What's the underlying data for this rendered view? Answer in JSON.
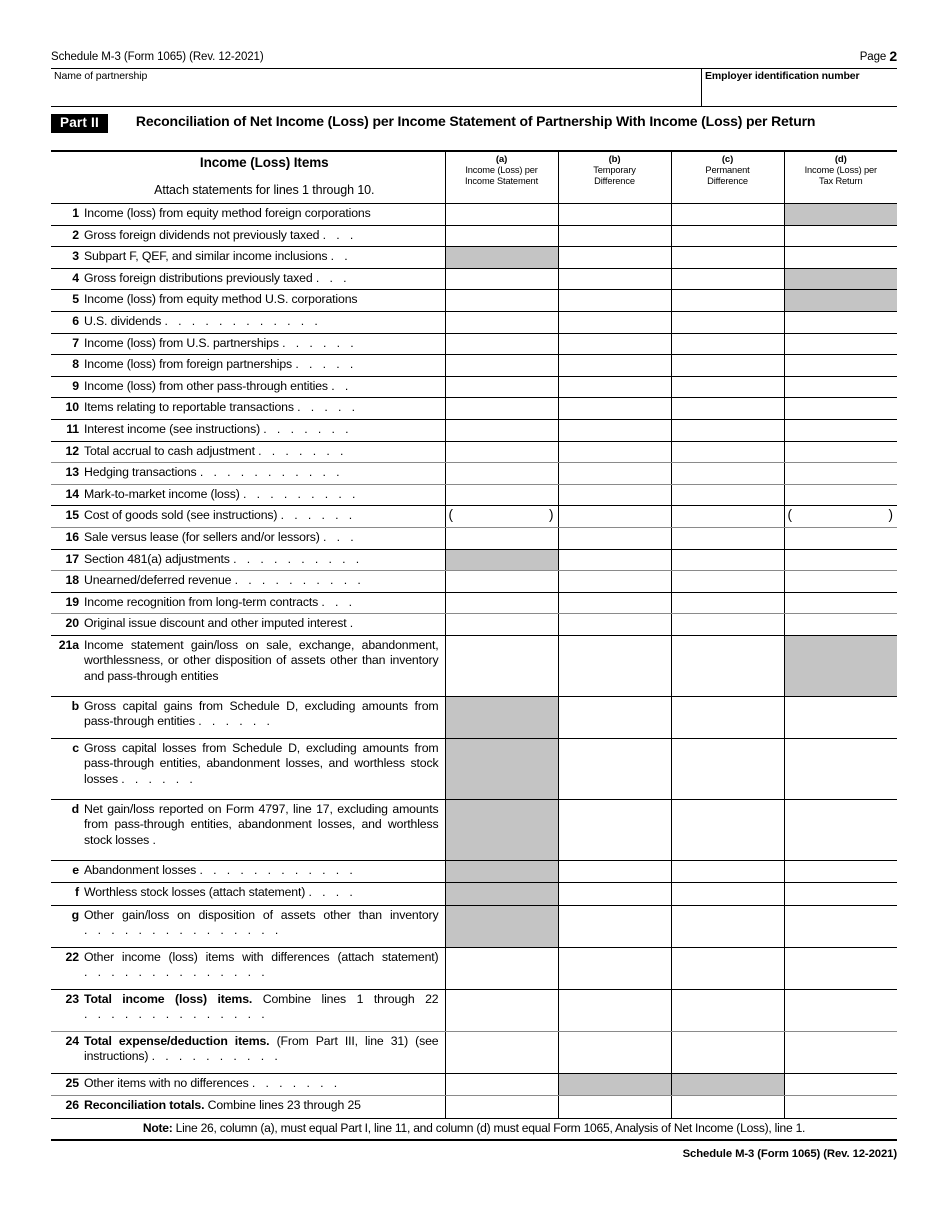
{
  "header": {
    "form_ref": "Schedule M-3 (Form 1065) (Rev. 12-2021)",
    "page_label": "Page",
    "page_number": "2",
    "name_of_partnership_label": "Name of partnership",
    "ein_label": "Employer identification number"
  },
  "part": {
    "tag": "Part II",
    "title": "Reconciliation of Net Income (Loss) per Income Statement of Partnership With Income (Loss) per Return"
  },
  "table_header": {
    "desc_title": "Income (Loss) Items",
    "desc_subtitle": "Attach statements for lines 1 through 10.",
    "columns": [
      {
        "letter": "(a)",
        "line1": "Income (Loss) per",
        "line2": "Income Statement"
      },
      {
        "letter": "(b)",
        "line1": "Temporary",
        "line2": "Difference"
      },
      {
        "letter": "(c)",
        "line1": "Permanent",
        "line2": "Difference"
      },
      {
        "letter": "(d)",
        "line1": "Income (Loss) per",
        "line2": "Tax Return"
      }
    ]
  },
  "rows": [
    {
      "num": "1",
      "text": "Income (loss) from equity method foreign corporations",
      "dots": ""
    },
    {
      "num": "2",
      "text": "Gross foreign dividends not previously taxed",
      "dots": ". . ."
    },
    {
      "num": "3",
      "text": "Subpart F, QEF, and similar income inclusions",
      "dots": ". ."
    },
    {
      "num": "4",
      "text": "Gross foreign distributions previously taxed",
      "dots": ". . ."
    },
    {
      "num": "5",
      "text": "Income (loss) from equity method U.S. corporations",
      "dots": ""
    },
    {
      "num": "6",
      "text": "U.S. dividends",
      "dots": ". . . . . . . . . . . ."
    },
    {
      "num": "7",
      "text": "Income (loss) from U.S. partnerships",
      "dots": ". . . . . ."
    },
    {
      "num": "8",
      "text": "Income (loss) from foreign partnerships",
      "dots": ". . . . ."
    },
    {
      "num": "9",
      "text": "Income (loss) from other pass-through entities",
      "dots": ". ."
    },
    {
      "num": "10",
      "text": "Items relating to reportable transactions",
      "dots": ". . . . ."
    },
    {
      "num": "11",
      "text": "Interest income (see instructions)",
      "dots": ". . . . . . ."
    },
    {
      "num": "12",
      "text": "Total accrual to cash adjustment",
      "dots": ". . . . . . ."
    },
    {
      "num": "13",
      "text": "Hedging transactions",
      "dots": ". . . . . . . . . . ."
    },
    {
      "num": "14",
      "text": "Mark-to-market income (loss)",
      "dots": ". . . . . . . . ."
    },
    {
      "num": "15",
      "text": "Cost of goods sold (see instructions)",
      "dots": ". . . . . ."
    },
    {
      "num": "16",
      "text": "Sale versus lease (for sellers and/or lessors)",
      "dots": ". . ."
    },
    {
      "num": "17",
      "text": "Section 481(a) adjustments",
      "dots": ". . . . . . . . . ."
    },
    {
      "num": "18",
      "text": "Unearned/deferred revenue",
      "dots": ". . . . . . . . . ."
    },
    {
      "num": "19",
      "text": "Income recognition from long-term contracts",
      "dots": ". . ."
    },
    {
      "num": "20",
      "text": "Original issue discount and other imputed interest",
      "dots": "."
    },
    {
      "num": "21a",
      "text": "Income statement gain/loss on sale, exchange, abandonment, worthlessness, or other disposition of assets other than inventory and pass-through entities",
      "dots": ""
    },
    {
      "num": "b",
      "text": "Gross capital gains from Schedule D, excluding amounts from pass-through entities",
      "dots": ". . . . . ."
    },
    {
      "num": "c",
      "text": "Gross capital losses from Schedule D, excluding amounts from pass-through entities, abandonment losses, and worthless stock losses",
      "dots": ". . . . . ."
    },
    {
      "num": "d",
      "text": "Net gain/loss reported on Form 4797, line 17, excluding amounts from pass-through entities, abandonment losses, and worthless stock losses",
      "dots": "."
    },
    {
      "num": "e",
      "text": "Abandonment losses",
      "dots": ". . . . . . . . . . . ."
    },
    {
      "num": "f",
      "text": "Worthless stock losses (attach statement)",
      "dots": ". . . ."
    },
    {
      "num": "g",
      "text": "Other gain/loss on disposition of assets other than inventory",
      "dots": ". . . . . . . . . . . . . . ."
    },
    {
      "num": "22",
      "text": "Other income (loss) items with differences (attach statement)",
      "dots": ". . . . . . . . . . . . . ."
    },
    {
      "num": "23",
      "text_bold": "Total income (loss) items.",
      "text": " Combine lines 1 through 22",
      "dots": ". . . . . . . . . . . . . ."
    },
    {
      "num": "24",
      "text_bold": "Total expense/deduction items.",
      "text": " (From Part III, line 31) (see instructions)",
      "dots": ". . . . . . . . . ."
    },
    {
      "num": "25",
      "text": "Other items with no differences",
      "dots": ". . . . . . ."
    },
    {
      "num": "26",
      "text_bold": "Reconciliation totals.",
      "text": " Combine lines 23 through 25",
      "dots": ""
    }
  ],
  "note": {
    "label": "Note:",
    "text": " Line 26, column (a), must equal Part I, line 11, and column (d) must equal Form 1065, Analysis of Net Income (Loss), line 1."
  },
  "footer": {
    "text": "Schedule M-3 (Form 1065) (Rev. 12-2021)"
  }
}
